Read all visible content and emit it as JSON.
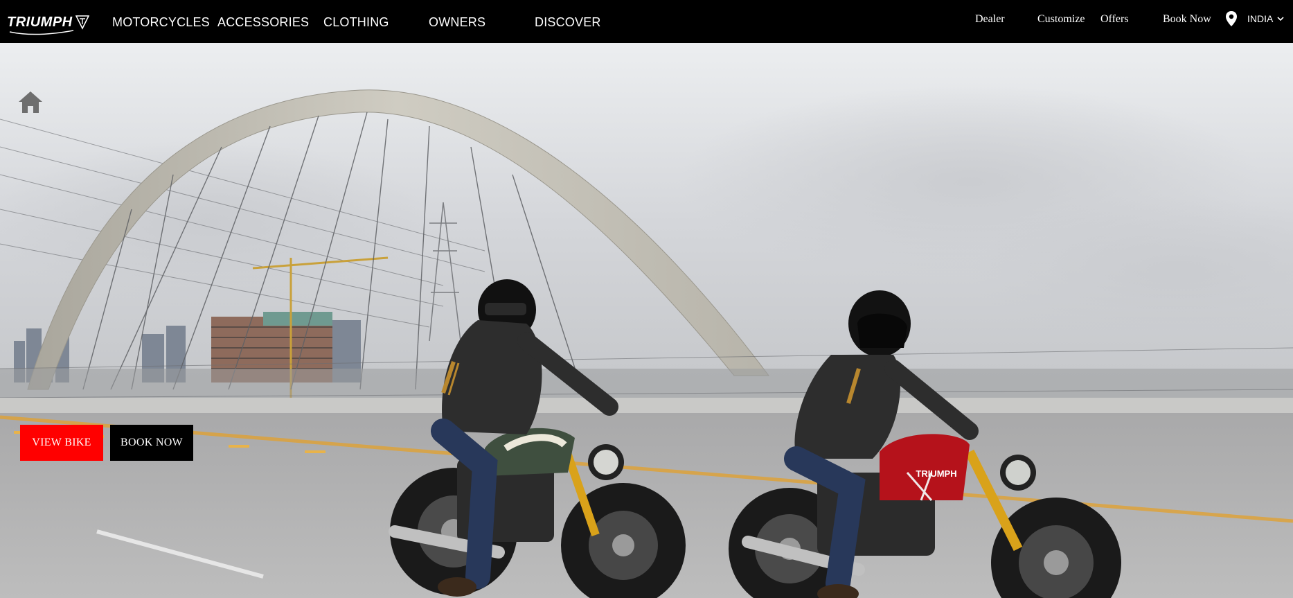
{
  "brand": {
    "name": "TRIUMPH"
  },
  "nav": {
    "items": [
      {
        "label": "MOTORCYCLES"
      },
      {
        "label": "ACCESSORIES"
      },
      {
        "label": "CLOTHING"
      },
      {
        "label": "OWNERS"
      },
      {
        "label": "DISCOVER"
      }
    ]
  },
  "utility": {
    "dealer": "Dealer",
    "customize": "Customize",
    "offers": "Offers",
    "book_now": "Book Now",
    "region": "INDIA"
  },
  "hero": {
    "view_bike": "VIEW BIKE",
    "book_now": "BOOK NOW",
    "tank_brand": "TRIUMPH"
  },
  "colors": {
    "header_bg": "#000000",
    "view_bike_bg": "#ff0000",
    "book_now_bg": "#000000",
    "bike_red": "#b5121b",
    "bike_green": "#3f4f3f",
    "fork_gold": "#d9a21a"
  },
  "icons": {
    "home": "home-icon",
    "location": "map-pin-icon",
    "chevron": "chevron-down-icon"
  }
}
